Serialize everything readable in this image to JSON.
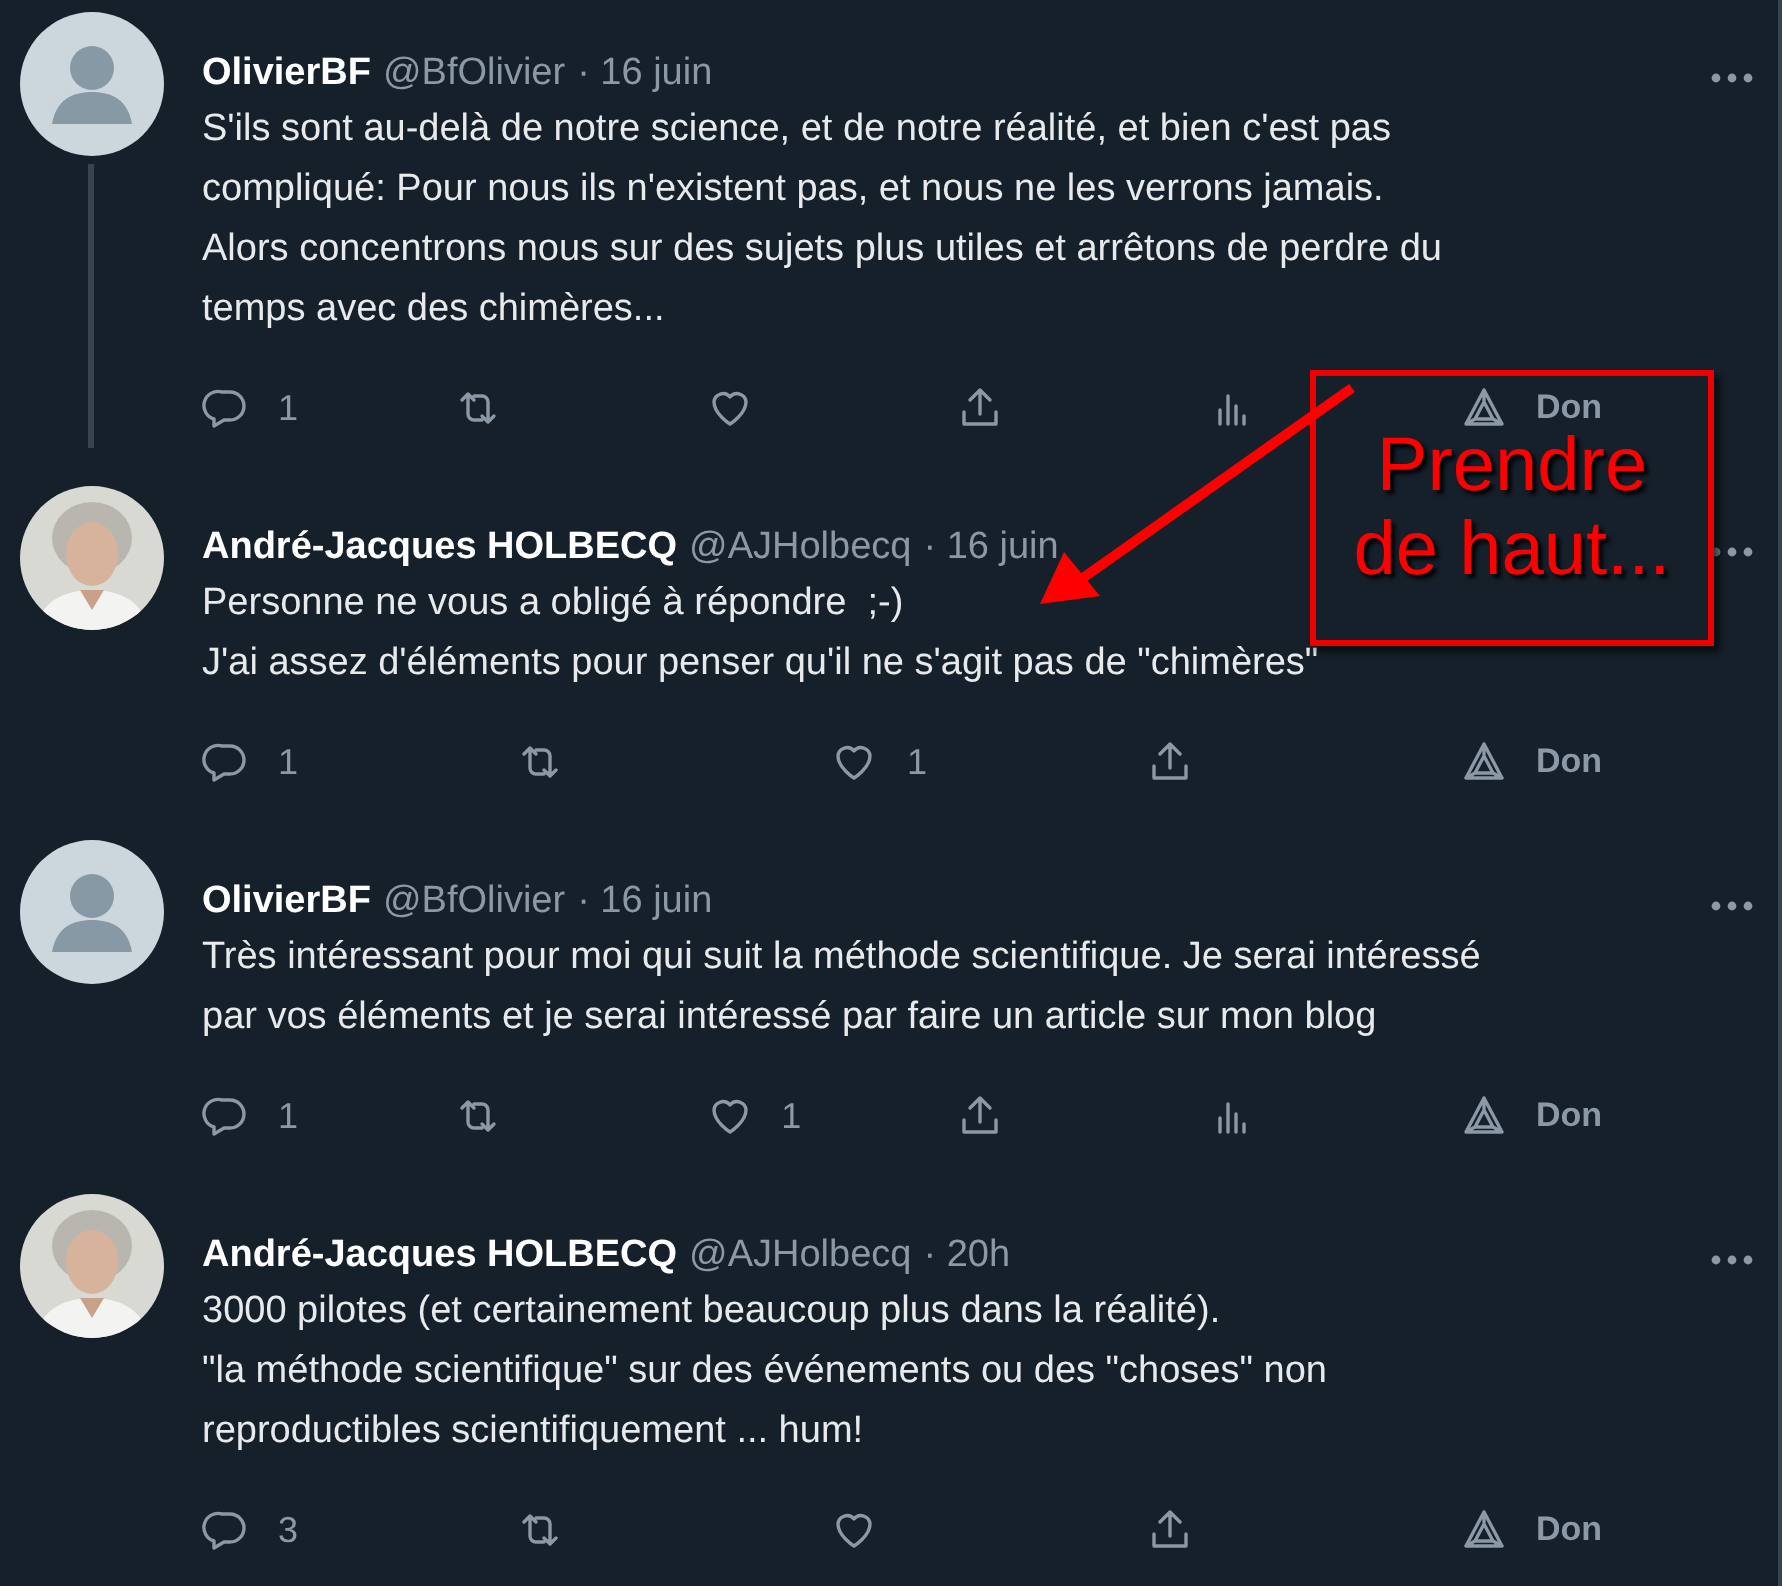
{
  "tweets": [
    {
      "author": "OlivierBF",
      "handle": "@BfOlivier",
      "time": "· 16 juin",
      "avatar": {
        "kind": "default"
      },
      "connected_below": true,
      "lines": [
        "S'ils sont au-delà de notre science, et de notre réalité, et bien c'est pas",
        "compliqué: Pour nous ils n'existent pas, et nous ne les verrons jamais.",
        "Alors concentrons nous sur des sujets plus utiles et arrêtons de perdre du",
        "temps avec des chimères..."
      ],
      "actions": [
        {
          "kind": "reply",
          "count": "1"
        },
        {
          "kind": "retweet"
        },
        {
          "kind": "like"
        },
        {
          "kind": "share"
        },
        {
          "kind": "analytics"
        },
        {
          "kind": "tip",
          "label": "Don"
        }
      ]
    },
    {
      "author": "André-Jacques HOLBECQ",
      "handle": "@AJHolbecq",
      "time": "· 16 juin",
      "avatar": {
        "kind": "picture"
      },
      "connected_below": false,
      "lines": [
        "Personne ne vous a obligé à répondre  ;-)",
        "J'ai assez d'éléments pour penser qu'il ne s'agit pas de \"chimères\""
      ],
      "actions": [
        {
          "kind": "reply",
          "count": "1"
        },
        {
          "kind": "retweet"
        },
        {
          "kind": "like",
          "count": "1"
        },
        {
          "kind": "share"
        },
        {
          "kind": "tip",
          "label": "Don"
        }
      ]
    },
    {
      "author": "OlivierBF",
      "handle": "@BfOlivier",
      "time": "· 16 juin",
      "avatar": {
        "kind": "default"
      },
      "connected_below": false,
      "lines": [
        "Très intéressant pour moi qui suit la méthode scientifique. Je serai intéressé",
        "par vos éléments et je serai intéressé par faire un article sur mon blog"
      ],
      "actions": [
        {
          "kind": "reply",
          "count": "1"
        },
        {
          "kind": "retweet"
        },
        {
          "kind": "like",
          "count": "1"
        },
        {
          "kind": "share"
        },
        {
          "kind": "analytics"
        },
        {
          "kind": "tip",
          "label": "Don"
        }
      ]
    },
    {
      "author": "André-Jacques HOLBECQ",
      "handle": "@AJHolbecq",
      "time": "· 20h",
      "avatar": {
        "kind": "picture"
      },
      "connected_below": false,
      "lines": [
        "3000 pilotes (et certainement beaucoup plus dans la réalité).",
        "\"la méthode scientifique\" sur des événements ou des \"choses\" non",
        "reproductibles scientifiquement ... hum!"
      ],
      "actions": [
        {
          "kind": "reply",
          "count": "3"
        },
        {
          "kind": "retweet"
        },
        {
          "kind": "like"
        },
        {
          "kind": "share"
        },
        {
          "kind": "tip",
          "label": "Don"
        }
      ]
    }
  ],
  "annotation": {
    "text": "Prendre de haut..."
  }
}
